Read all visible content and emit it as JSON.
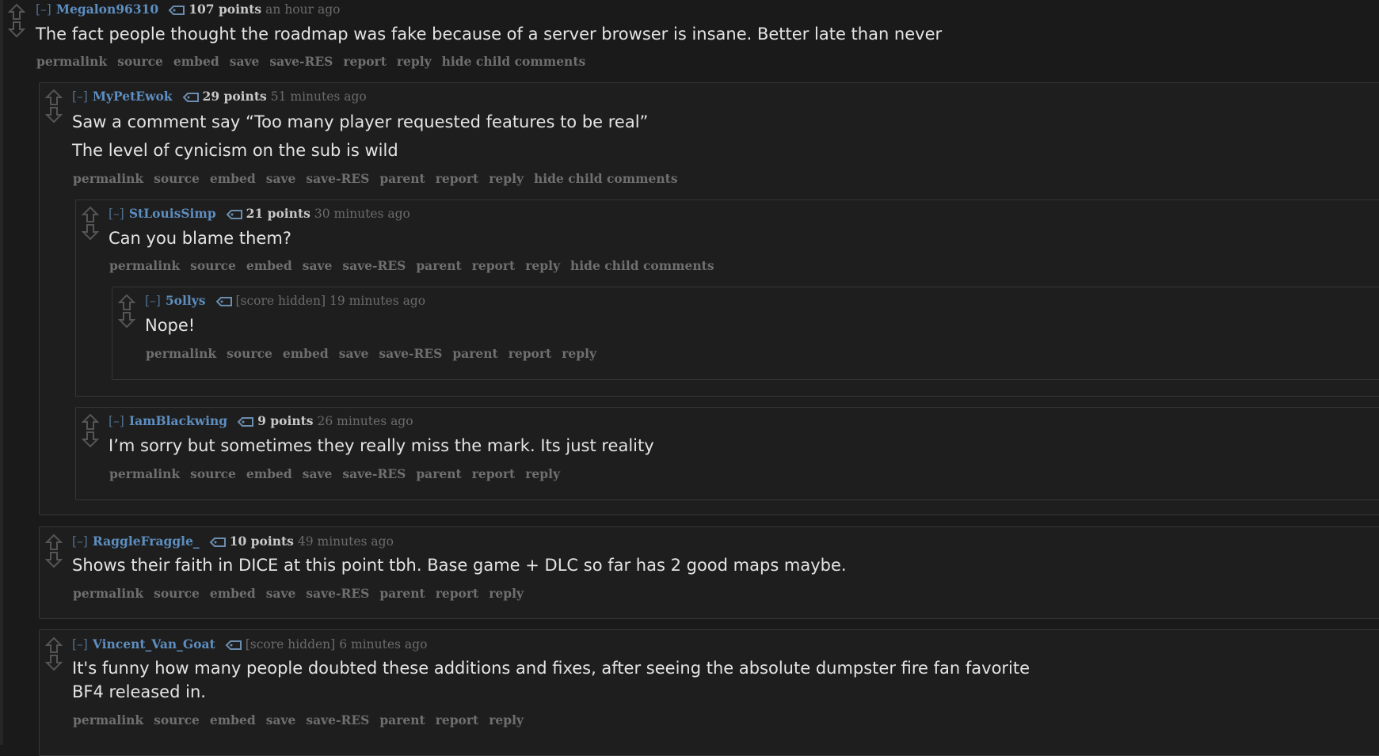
{
  "comments": [
    {
      "expand": "[–]",
      "author": "Megalon96310",
      "score": "107 points",
      "time": "an hour ago",
      "body": [
        "The fact people thought the roadmap was fake because of a server browser is insane. Better late than never"
      ],
      "buttons": [
        "permalink",
        "source",
        "embed",
        "save",
        "save-RES",
        "report",
        "reply",
        "hide child comments"
      ]
    },
    {
      "expand": "[–]",
      "author": "MyPetEwok",
      "score": "29 points",
      "time": "51 minutes ago",
      "body": [
        "Saw a comment say “Too many player requested features to be real”",
        "The level of cynicism on the sub is wild"
      ],
      "buttons": [
        "permalink",
        "source",
        "embed",
        "save",
        "save-RES",
        "parent",
        "report",
        "reply",
        "hide child comments"
      ]
    },
    {
      "expand": "[–]",
      "author": "StLouisSimp",
      "score": "21 points",
      "time": "30 minutes ago",
      "body": [
        "Can you blame them?"
      ],
      "buttons": [
        "permalink",
        "source",
        "embed",
        "save",
        "save-RES",
        "parent",
        "report",
        "reply",
        "hide child comments"
      ]
    },
    {
      "expand": "[–]",
      "author": "5ollys",
      "score": "[score hidden]",
      "time": "19 minutes ago",
      "body": [
        "Nope!"
      ],
      "buttons": [
        "permalink",
        "source",
        "embed",
        "save",
        "save-RES",
        "parent",
        "report",
        "reply"
      ]
    },
    {
      "expand": "[–]",
      "author": "IamBlackwing",
      "score": "9 points",
      "time": "26 minutes ago",
      "body": [
        "I’m sorry but sometimes they really miss the mark. Its just reality"
      ],
      "buttons": [
        "permalink",
        "source",
        "embed",
        "save",
        "save-RES",
        "parent",
        "report",
        "reply"
      ]
    },
    {
      "expand": "[–]",
      "author": "RaggleFraggle_",
      "score": "10 points",
      "time": "49 minutes ago",
      "body": [
        "Shows their faith in DICE at this point tbh. Base game + DLC so far has 2 good maps maybe."
      ],
      "buttons": [
        "permalink",
        "source",
        "embed",
        "save",
        "save-RES",
        "parent",
        "report",
        "reply"
      ]
    },
    {
      "expand": "[–]",
      "author": "Vincent_Van_Goat",
      "score": "[score hidden]",
      "time": "6 minutes ago",
      "body": [
        "It's funny how many people doubted these additions and fixes, after seeing the absolute dumpster fire fan favorite",
        "BF4 released in."
      ],
      "buttons": [
        "permalink",
        "source",
        "embed",
        "save",
        "save-RES",
        "parent",
        "report",
        "reply"
      ]
    }
  ],
  "colors": {
    "background": "#1a1a1b",
    "nested_background": "#1e1e1e",
    "border": "#363636",
    "author": "#5d8ec0",
    "body_text": "#e4e4e4",
    "meta_text": "#6b6b6b"
  }
}
